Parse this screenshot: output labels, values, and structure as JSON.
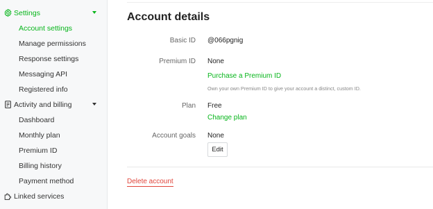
{
  "sidebar": {
    "settings": {
      "label": "Settings",
      "items": [
        {
          "label": "Account settings",
          "active": true
        },
        {
          "label": "Manage permissions"
        },
        {
          "label": "Response settings"
        },
        {
          "label": "Messaging API"
        },
        {
          "label": "Registered info"
        }
      ]
    },
    "billing": {
      "label": "Activity and billing",
      "items": [
        {
          "label": "Dashboard"
        },
        {
          "label": "Monthly plan"
        },
        {
          "label": "Premium ID"
        },
        {
          "label": "Billing history"
        },
        {
          "label": "Payment method"
        }
      ]
    },
    "linked": {
      "label": "Linked services"
    }
  },
  "main": {
    "title": "Account details",
    "basic_id": {
      "label": "Basic ID",
      "value": "@066pgnig"
    },
    "premium_id": {
      "label": "Premium ID",
      "value": "None",
      "link": "Purchase a Premium ID",
      "help": "Own your own Premium ID to give your account a distinct, custom ID."
    },
    "plan": {
      "label": "Plan",
      "value": "Free",
      "link": "Change plan"
    },
    "account_goals": {
      "label": "Account goals",
      "value": "None",
      "edit": "Edit"
    },
    "delete": "Delete account"
  },
  "colors": {
    "accent": "#06b51a",
    "danger": "#e0453b"
  }
}
